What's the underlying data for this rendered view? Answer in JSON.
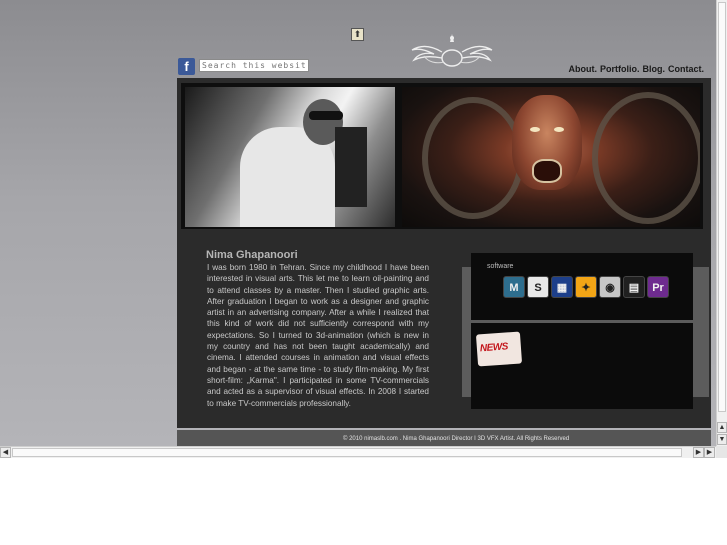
{
  "header": {
    "search_placeholder": "Search this website",
    "nav": [
      {
        "label": "About."
      },
      {
        "label": "Portfolio."
      },
      {
        "label": "Blog."
      },
      {
        "label": "Contact."
      }
    ]
  },
  "bio": {
    "name": "Nima Ghapanoori",
    "text": "I was born 1980 in Tehran. Since my childhood I have been interested in visual arts. This let me to learn oil-painting and to attend classes by a master. Then I studied graphic arts. After graduation I began to work as a designer and graphic artist in an advertising company. After a while I realized that this kind of work did not sufficiently correspond with my expectations. So I turned to 3d-animation (which is new in my country and has not been taught academically) and cinema. I attended courses in animation and visual effects and began - at the same time - to study film-making. My first short-film: „Karma\". I participated in some TV-commercials and acted as a supervisor of visual effects. In 2008 I started to make TV-commercials professionally."
  },
  "software": {
    "label": "software",
    "icons": [
      {
        "name": "maya-icon",
        "color": "#2e6e8e",
        "glyph": "M"
      },
      {
        "name": "softimage-icon",
        "color": "#e9e9e9",
        "glyph": "S"
      },
      {
        "name": "shake-icon",
        "color": "#1d3f8a",
        "glyph": "▦"
      },
      {
        "name": "nuke-icon",
        "color": "#f2a516",
        "glyph": "✦"
      },
      {
        "name": "dvd-studio-icon",
        "color": "#c7c7c7",
        "glyph": "◉"
      },
      {
        "name": "final-cut-icon",
        "color": "#202020",
        "glyph": "▤"
      },
      {
        "name": "premiere-icon",
        "color": "#6e2b8f",
        "glyph": "Pr"
      }
    ]
  },
  "news": {
    "label": "NEWS"
  },
  "footer": {
    "text": "© 2010 nimaslb.com . Nima Ghapanoori Director I 3D VFX Artist. All Rights Reserved"
  }
}
